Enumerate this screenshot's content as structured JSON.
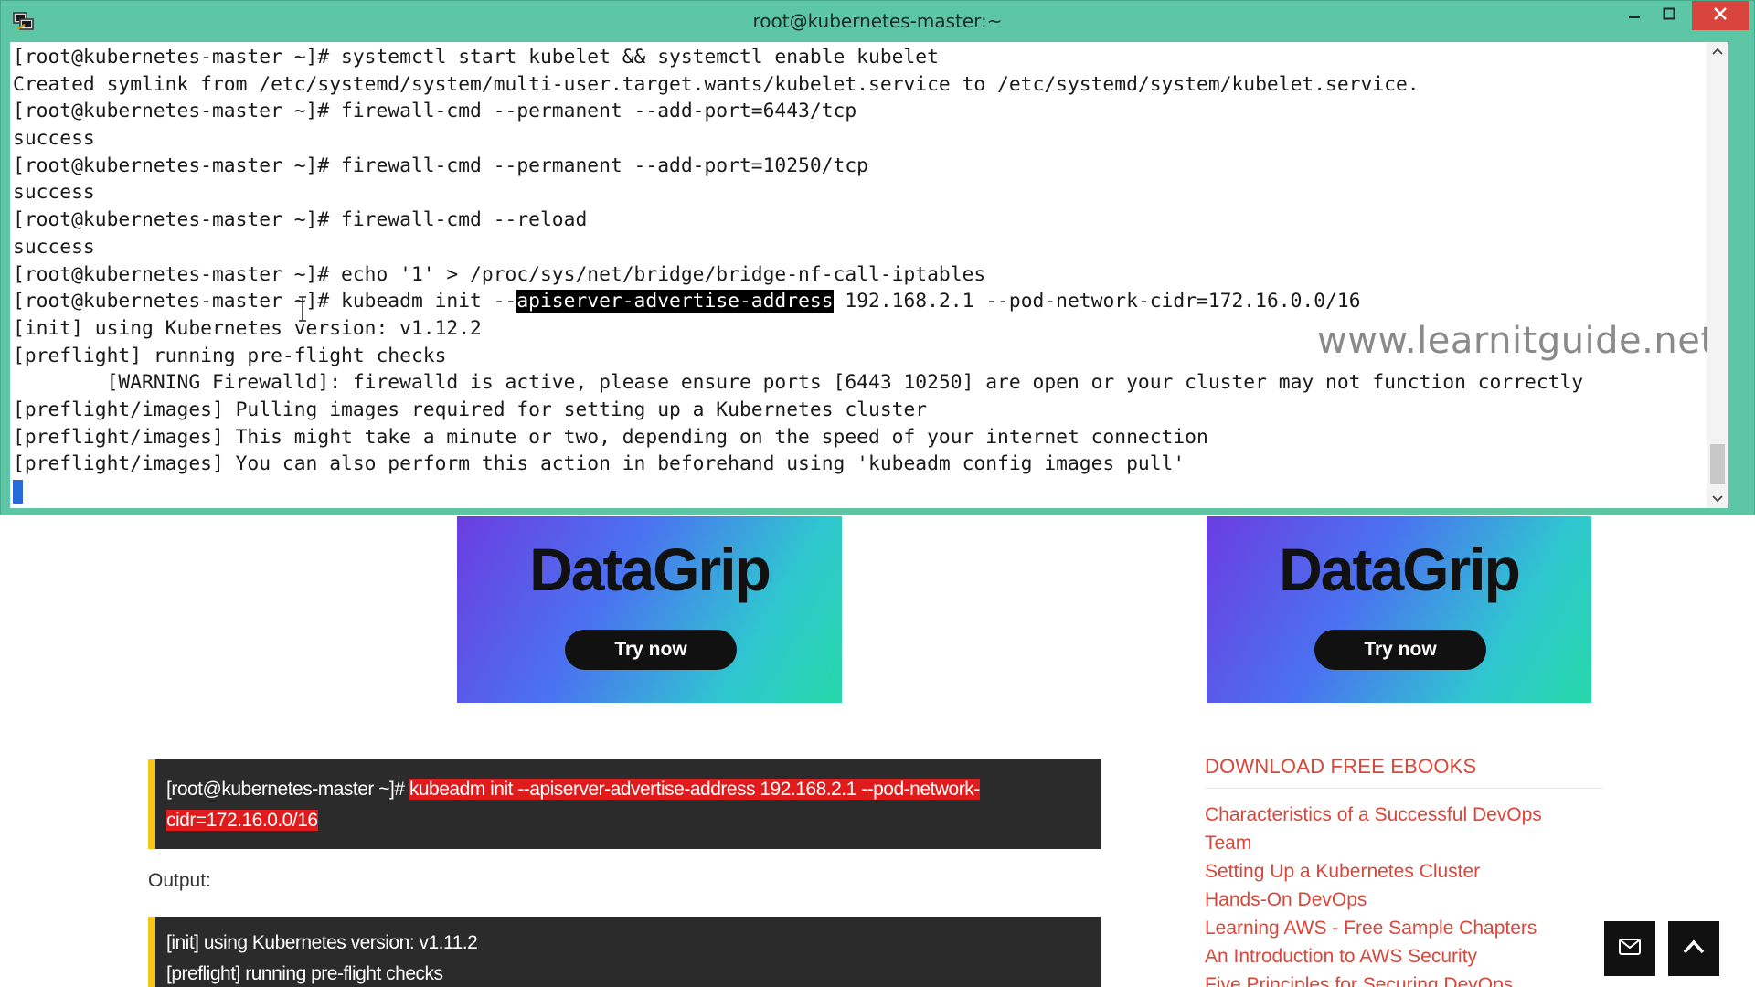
{
  "window": {
    "title": "root@kubernetes-master:~",
    "icon": "putty-icon",
    "controls": [
      "minimize-icon",
      "maximize-icon",
      "close-icon"
    ],
    "accent_color": "#5cc6a5"
  },
  "terminal": {
    "lines": [
      {
        "text": "[root@kubernetes-master ~]# systemctl start kubelet && systemctl enable kubelet"
      },
      {
        "text": "Created symlink from /etc/systemd/system/multi-user.target.wants/kubelet.service to /etc/systemd/system/kubelet.service."
      },
      {
        "text": "[root@kubernetes-master ~]# firewall-cmd --permanent --add-port=6443/tcp"
      },
      {
        "text": "success"
      },
      {
        "text": "[root@kubernetes-master ~]# firewall-cmd --permanent --add-port=10250/tcp"
      },
      {
        "text": "success"
      },
      {
        "text": "[root@kubernetes-master ~]# firewall-cmd --reload"
      },
      {
        "text": "success"
      },
      {
        "text": "[root@kubernetes-master ~]# echo '1' > /proc/sys/net/bridge/bridge-nf-call-iptables"
      },
      {
        "pre": "[root@kubernetes-master ~]# kubeadm init --",
        "highlight": "apiserver-advertise-address",
        "post": " 192.168.2.1 --pod-network-cidr=172.16.0.0/16"
      },
      {
        "text": "[init] using Kubernetes version: v1.12.2"
      },
      {
        "text": "[preflight] running pre-flight checks"
      },
      {
        "text": "        [WARNING Firewalld]: firewalld is active, please ensure ports [6443 10250] are open or your cluster may not function correctly"
      },
      {
        "text": "[preflight/images] Pulling images required for setting up a Kubernetes cluster"
      },
      {
        "text": "[preflight/images] This might take a minute or two, depending on the speed of your internet connection"
      },
      {
        "text": "[preflight/images] You can also perform this action in beforehand using 'kubeadm config images pull'"
      }
    ],
    "watermark": "www.learnitguide.net",
    "cursor_color": "#2a6ad8"
  },
  "page": {
    "ads": [
      {
        "title": "DataGrip",
        "button": "Try now"
      },
      {
        "title": "DataGrip",
        "button": "Try now"
      }
    ],
    "code_block_1": {
      "prompt": "[root@kubernetes-master ~]# ",
      "command_line1": "kubeadm init --apiserver-advertise-address 192.168.2.1 --pod-network-",
      "command_line2": "cidr=172.16.0.0/16"
    },
    "output_label": "Output:",
    "code_block_2": {
      "lines": [
        "[init] using Kubernetes version: v1.11.2",
        "[preflight] running pre-flight checks"
      ]
    },
    "sidebar": {
      "heading": "DOWNLOAD FREE EBOOKS",
      "links": [
        "Characteristics of a Successful DevOps",
        "Team",
        "Setting Up a Kubernetes Cluster",
        "Hands-On DevOps",
        "Learning AWS - Free Sample Chapters",
        "An Introduction to AWS Security",
        "Five Principles for Securing DevOps"
      ],
      "link_color": "#d9463a"
    },
    "floating_buttons": [
      "mail-icon",
      "arrow-up-icon"
    ]
  }
}
